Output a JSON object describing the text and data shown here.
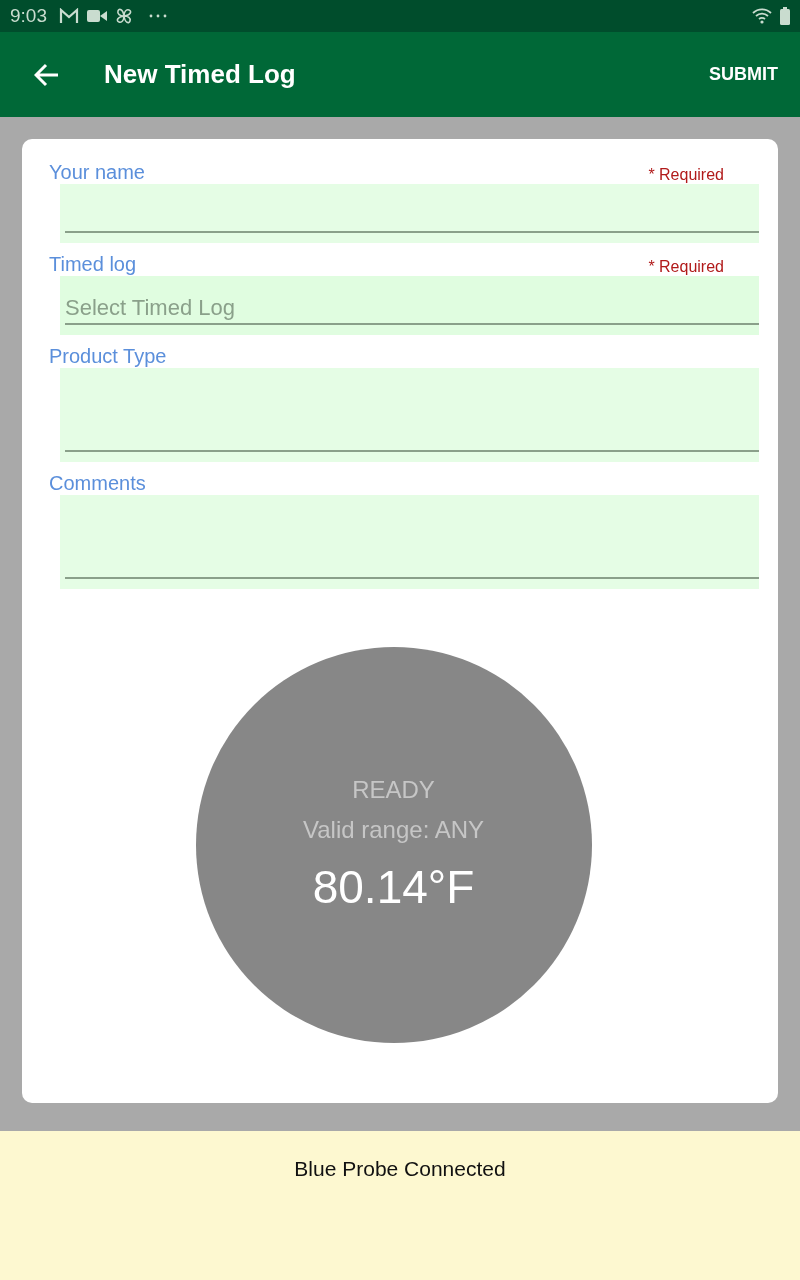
{
  "status_bar": {
    "time": "9:03"
  },
  "app_bar": {
    "title": "New Timed Log",
    "action": "SUBMIT"
  },
  "fields": [
    {
      "label": "Your name",
      "required_text": "* Required",
      "kind": "text"
    },
    {
      "label": "Timed log",
      "required_text": "* Required",
      "kind": "select",
      "placeholder": "Select Timed Log"
    },
    {
      "label": "Product Type",
      "kind": "multiline"
    },
    {
      "label": "Comments",
      "kind": "multiline"
    }
  ],
  "reading": {
    "status": "READY",
    "range": "Valid range: ANY",
    "temperature": "80.14°F"
  },
  "footer": {
    "message": "Blue Probe Connected"
  }
}
